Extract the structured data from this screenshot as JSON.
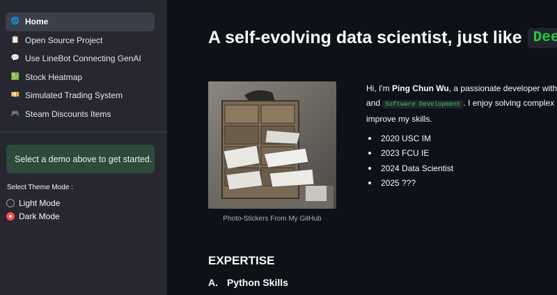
{
  "sidebar": {
    "nav": [
      {
        "icon": "globe-icon",
        "glyph": "🌐",
        "label": "Home",
        "active": true
      },
      {
        "icon": "clipboard-icon",
        "glyph": "📋",
        "label": "Open Source Project",
        "active": false
      },
      {
        "icon": "speech-bubble-icon",
        "glyph": "💬",
        "label": "Use LineBot Connecting GenAI",
        "active": false
      },
      {
        "icon": "chart-icon",
        "glyph": "💹",
        "label": "Stock Heatmap",
        "active": false
      },
      {
        "icon": "money-icon",
        "glyph": "💴",
        "label": "Simulated Trading System",
        "active": false
      },
      {
        "icon": "gamepad-icon",
        "glyph": "🎮",
        "label": "Steam Discounts Items",
        "active": false
      }
    ],
    "info": "Select a demo above to get started.",
    "theme_label": "Select Theme Mode :",
    "theme_options": [
      {
        "label": "Light Mode",
        "selected": false
      },
      {
        "label": "Dark Mode",
        "selected": true
      }
    ]
  },
  "main": {
    "title_text": "A self-evolving data scientist, just like",
    "title_code": "Deep Learning",
    "photo_caption": "Photo-Stickers From My GitHub",
    "intro": {
      "p1": "Hi, I'm ",
      "name": "Ping Chun Wu",
      "p2": ", a passionate developer with a focus on",
      "p3": "and ",
      "code": "Software Development",
      "p4": ". I enjoy solving complex problems and",
      "p5": "improve my skills."
    },
    "milestones": [
      "2020 USC IM",
      "2023 FCU IE",
      "2024 Data Scientist",
      "2025 ???"
    ],
    "expertise_heading": "EXPERTISE",
    "skill_number": "A.",
    "skill_heading": "Python Skills"
  },
  "colors": {
    "accent_red": "#ff4b4b",
    "code_green": "#27c93f",
    "info_bg": "#2d4a3a",
    "sidebar_bg": "#262730",
    "main_bg": "#0e1117"
  }
}
